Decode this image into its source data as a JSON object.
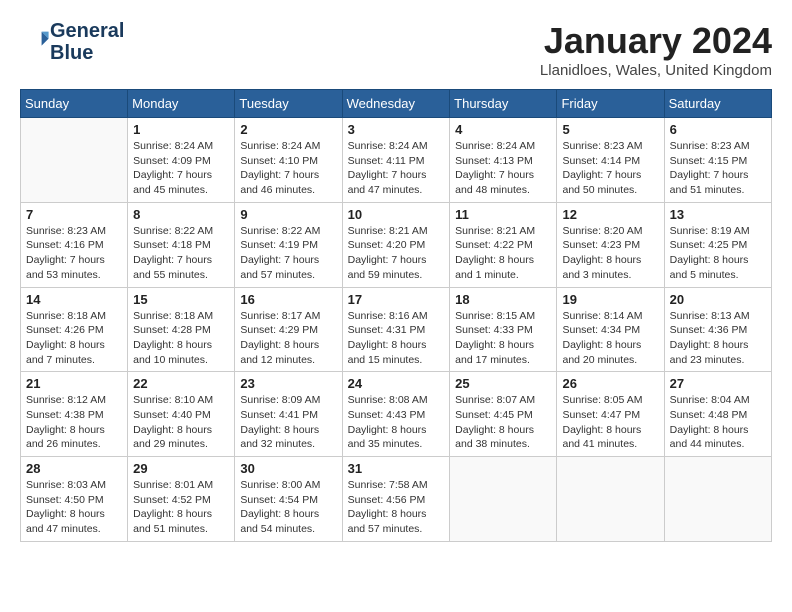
{
  "header": {
    "logo_line1": "General",
    "logo_line2": "Blue",
    "month": "January 2024",
    "location": "Llanidloes, Wales, United Kingdom"
  },
  "days_of_week": [
    "Sunday",
    "Monday",
    "Tuesday",
    "Wednesday",
    "Thursday",
    "Friday",
    "Saturday"
  ],
  "weeks": [
    [
      {
        "day": "",
        "info": ""
      },
      {
        "day": "1",
        "info": "Sunrise: 8:24 AM\nSunset: 4:09 PM\nDaylight: 7 hours\nand 45 minutes."
      },
      {
        "day": "2",
        "info": "Sunrise: 8:24 AM\nSunset: 4:10 PM\nDaylight: 7 hours\nand 46 minutes."
      },
      {
        "day": "3",
        "info": "Sunrise: 8:24 AM\nSunset: 4:11 PM\nDaylight: 7 hours\nand 47 minutes."
      },
      {
        "day": "4",
        "info": "Sunrise: 8:24 AM\nSunset: 4:13 PM\nDaylight: 7 hours\nand 48 minutes."
      },
      {
        "day": "5",
        "info": "Sunrise: 8:23 AM\nSunset: 4:14 PM\nDaylight: 7 hours\nand 50 minutes."
      },
      {
        "day": "6",
        "info": "Sunrise: 8:23 AM\nSunset: 4:15 PM\nDaylight: 7 hours\nand 51 minutes."
      }
    ],
    [
      {
        "day": "7",
        "info": "Sunrise: 8:23 AM\nSunset: 4:16 PM\nDaylight: 7 hours\nand 53 minutes."
      },
      {
        "day": "8",
        "info": "Sunrise: 8:22 AM\nSunset: 4:18 PM\nDaylight: 7 hours\nand 55 minutes."
      },
      {
        "day": "9",
        "info": "Sunrise: 8:22 AM\nSunset: 4:19 PM\nDaylight: 7 hours\nand 57 minutes."
      },
      {
        "day": "10",
        "info": "Sunrise: 8:21 AM\nSunset: 4:20 PM\nDaylight: 7 hours\nand 59 minutes."
      },
      {
        "day": "11",
        "info": "Sunrise: 8:21 AM\nSunset: 4:22 PM\nDaylight: 8 hours\nand 1 minute."
      },
      {
        "day": "12",
        "info": "Sunrise: 8:20 AM\nSunset: 4:23 PM\nDaylight: 8 hours\nand 3 minutes."
      },
      {
        "day": "13",
        "info": "Sunrise: 8:19 AM\nSunset: 4:25 PM\nDaylight: 8 hours\nand 5 minutes."
      }
    ],
    [
      {
        "day": "14",
        "info": "Sunrise: 8:18 AM\nSunset: 4:26 PM\nDaylight: 8 hours\nand 7 minutes."
      },
      {
        "day": "15",
        "info": "Sunrise: 8:18 AM\nSunset: 4:28 PM\nDaylight: 8 hours\nand 10 minutes."
      },
      {
        "day": "16",
        "info": "Sunrise: 8:17 AM\nSunset: 4:29 PM\nDaylight: 8 hours\nand 12 minutes."
      },
      {
        "day": "17",
        "info": "Sunrise: 8:16 AM\nSunset: 4:31 PM\nDaylight: 8 hours\nand 15 minutes."
      },
      {
        "day": "18",
        "info": "Sunrise: 8:15 AM\nSunset: 4:33 PM\nDaylight: 8 hours\nand 17 minutes."
      },
      {
        "day": "19",
        "info": "Sunrise: 8:14 AM\nSunset: 4:34 PM\nDaylight: 8 hours\nand 20 minutes."
      },
      {
        "day": "20",
        "info": "Sunrise: 8:13 AM\nSunset: 4:36 PM\nDaylight: 8 hours\nand 23 minutes."
      }
    ],
    [
      {
        "day": "21",
        "info": "Sunrise: 8:12 AM\nSunset: 4:38 PM\nDaylight: 8 hours\nand 26 minutes."
      },
      {
        "day": "22",
        "info": "Sunrise: 8:10 AM\nSunset: 4:40 PM\nDaylight: 8 hours\nand 29 minutes."
      },
      {
        "day": "23",
        "info": "Sunrise: 8:09 AM\nSunset: 4:41 PM\nDaylight: 8 hours\nand 32 minutes."
      },
      {
        "day": "24",
        "info": "Sunrise: 8:08 AM\nSunset: 4:43 PM\nDaylight: 8 hours\nand 35 minutes."
      },
      {
        "day": "25",
        "info": "Sunrise: 8:07 AM\nSunset: 4:45 PM\nDaylight: 8 hours\nand 38 minutes."
      },
      {
        "day": "26",
        "info": "Sunrise: 8:05 AM\nSunset: 4:47 PM\nDaylight: 8 hours\nand 41 minutes."
      },
      {
        "day": "27",
        "info": "Sunrise: 8:04 AM\nSunset: 4:48 PM\nDaylight: 8 hours\nand 44 minutes."
      }
    ],
    [
      {
        "day": "28",
        "info": "Sunrise: 8:03 AM\nSunset: 4:50 PM\nDaylight: 8 hours\nand 47 minutes."
      },
      {
        "day": "29",
        "info": "Sunrise: 8:01 AM\nSunset: 4:52 PM\nDaylight: 8 hours\nand 51 minutes."
      },
      {
        "day": "30",
        "info": "Sunrise: 8:00 AM\nSunset: 4:54 PM\nDaylight: 8 hours\nand 54 minutes."
      },
      {
        "day": "31",
        "info": "Sunrise: 7:58 AM\nSunset: 4:56 PM\nDaylight: 8 hours\nand 57 minutes."
      },
      {
        "day": "",
        "info": ""
      },
      {
        "day": "",
        "info": ""
      },
      {
        "day": "",
        "info": ""
      }
    ]
  ]
}
